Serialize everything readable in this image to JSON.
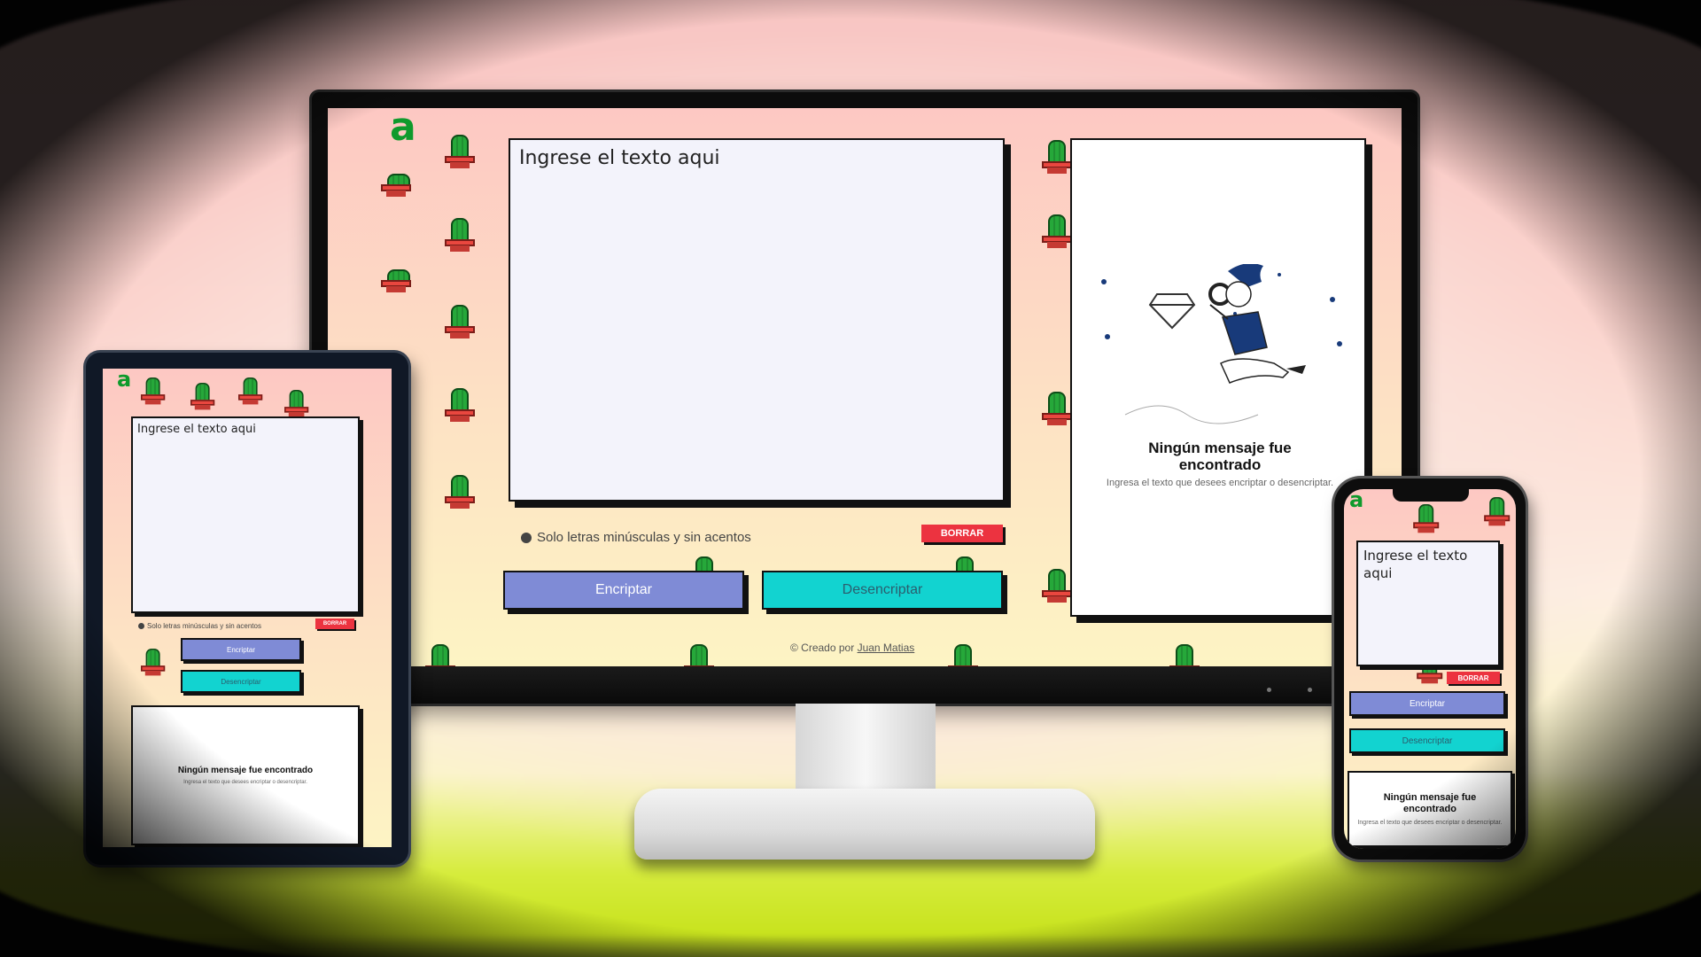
{
  "app": {
    "logo": "a",
    "input_placeholder": "Ingrese el texto aqui",
    "hint": "Solo letras minúsculas y sin acentos",
    "clear_label": "BORRAR",
    "encrypt_label": "Encriptar",
    "decrypt_label": "Desencriptar",
    "output_title": "Ningún mensaje fue encontrado",
    "output_description": "Ingresa el texto que desees encriptar o desencriptar.",
    "footer_prefix": "© Creado por",
    "footer_author": "Juan Matias"
  },
  "colors": {
    "encrypt_button": "#7f8bd6",
    "decrypt_button": "#12d3d0",
    "clear_button": "#ec3340",
    "logo": "#0e9a2c",
    "cactus": "#26a83a",
    "pot": "#e9473f"
  },
  "icons": {
    "hint": "info-dot-icon",
    "illustration": "person-magnifier-diamond-illustration",
    "decoration": "pixel-cactus-icon"
  }
}
